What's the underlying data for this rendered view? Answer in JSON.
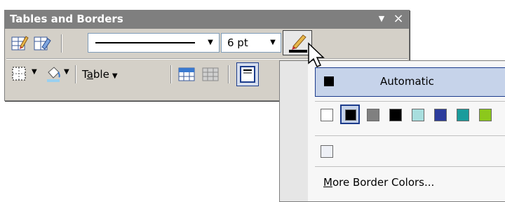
{
  "toolbar": {
    "title": "Tables and Borders",
    "dropdown_glyph": "▼",
    "close_glyph": "×",
    "line_weight": "6 pt",
    "table_menu_label_prefix": "T",
    "table_menu_label_underlined": "a",
    "table_menu_label_suffix": "ble",
    "icons_row1": [
      "draw-table-icon",
      "eraser-icon",
      "line-style-dropdown",
      "line-weight-dropdown",
      "border-color-icon"
    ],
    "icons_row2": [
      "outside-border-icon",
      "shading-color-icon",
      "table-menu",
      "merge-cells-icon",
      "split-cells-icon",
      "align-top-icon"
    ]
  },
  "border_color_menu": {
    "automatic_label": "Automatic",
    "more_colors_prefix": "",
    "more_colors_underlined": "M",
    "more_colors_suffix": "ore Border Colors...",
    "swatches": [
      "#ffffff",
      "#000000",
      "#808080",
      "#000000",
      "#a8dede",
      "#2c3c9c",
      "#1a9c9c",
      "#8cc81c"
    ],
    "selected_index": 1,
    "recent_swatch": "#eef0f6"
  },
  "colors": {
    "title_bar": "#7f7f7f",
    "toolbar_bg": "#d4d0c8",
    "highlight": "#c6d3ea",
    "highlight_border": "#1c3c8c"
  }
}
